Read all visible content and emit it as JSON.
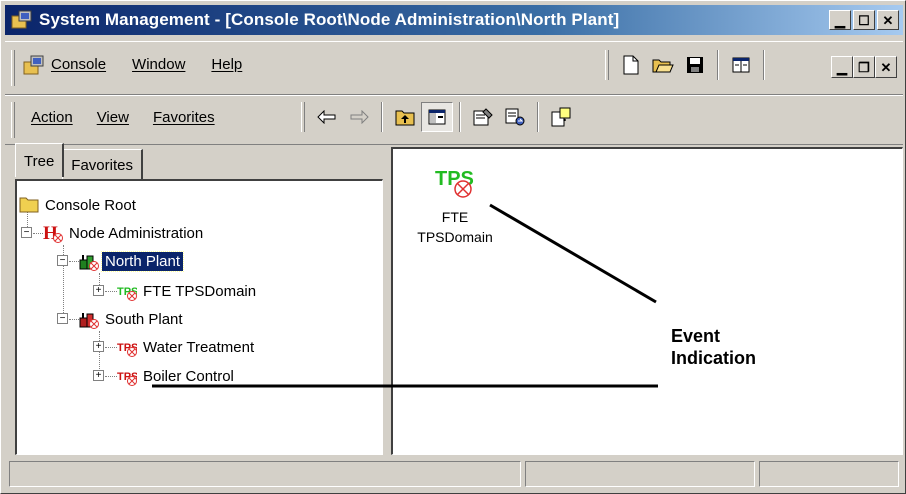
{
  "window": {
    "title": "System Management - [Console Root\\Node Administration\\North Plant]",
    "controls": [
      "minimize-icon",
      "maximize-icon",
      "close-icon"
    ]
  },
  "menubar": {
    "items": [
      {
        "label": "Console",
        "accel": "C"
      },
      {
        "label": "Window",
        "accel": "W"
      },
      {
        "label": "Help",
        "accel": "H"
      }
    ],
    "toolbar_icons": [
      "new-document-icon",
      "open-folder-icon",
      "save-icon",
      "properties-list-icon"
    ],
    "mdi_controls": [
      "minimize-icon",
      "restore-icon",
      "close-icon"
    ]
  },
  "actionbar": {
    "items": [
      {
        "label": "Action",
        "accel": "A"
      },
      {
        "label": "View",
        "accel": "V"
      },
      {
        "label": "Favorites",
        "accel": "F"
      }
    ],
    "toolbar_icons": [
      "back-arrow-icon",
      "forward-arrow-icon",
      "up-folder-icon",
      "show-tree-icon",
      "properties-icon",
      "export-list-icon",
      "help-icon"
    ]
  },
  "tabs": [
    {
      "label": "Tree",
      "active": true
    },
    {
      "label": "Favorites",
      "active": false
    }
  ],
  "tree": {
    "console_root": "Console Root",
    "node_admin": "Node Administration",
    "north_plant": "North Plant",
    "fte_tps": "FTE TPSDomain",
    "south_plant": "South Plant",
    "water": "Water Treatment",
    "boiler": "Boiler Control"
  },
  "list_view": {
    "item_icon_text": "TPS",
    "item_label_line1": "FTE",
    "item_label_line2": "TPSDomain"
  },
  "annotation": {
    "line1": "Event",
    "line2": "Indication"
  },
  "tree_icon_text": "TPS",
  "colors": {
    "title_bar": "#0a246a",
    "selection": "#0a246a",
    "tps_green": "#22bb22",
    "tps_red": "#cc1111",
    "alarm_red": "#e03030"
  }
}
